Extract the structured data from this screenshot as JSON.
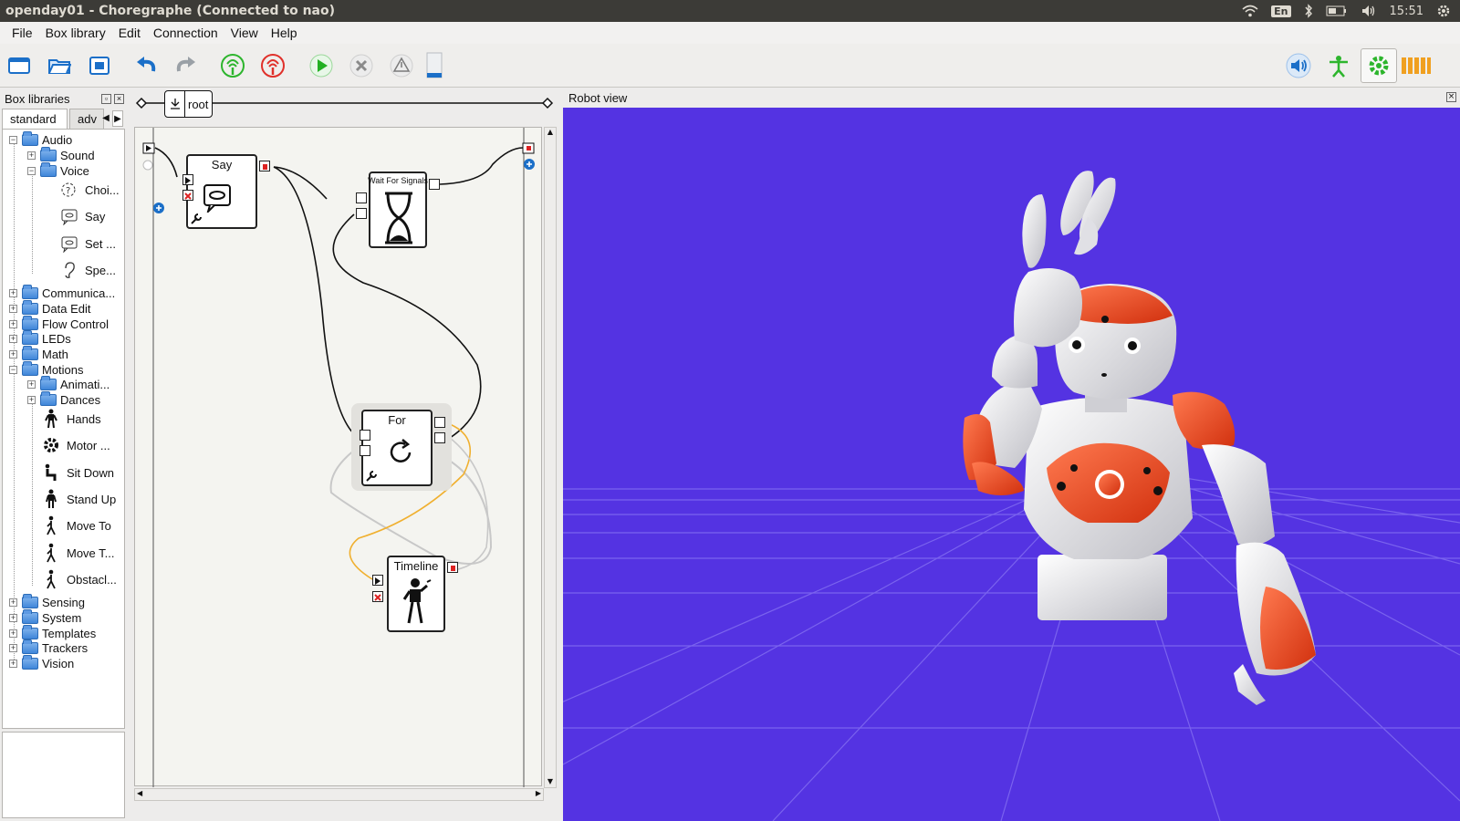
{
  "window": {
    "title": "openday01 - Choregraphe (Connected to nao)",
    "keyboard_layout": "En",
    "clock": "15:51"
  },
  "menu": [
    "File",
    "Box library",
    "Edit",
    "Connection",
    "View",
    "Help"
  ],
  "toolbar": {
    "left_icons": [
      "new-project-icon",
      "open-project-icon",
      "save-project-icon",
      "undo-icon",
      "redo-icon",
      "connect-icon",
      "disconnect-icon",
      "play-icon",
      "stop-icon",
      "warning-icon",
      "battery-icon"
    ],
    "right_icons": [
      "volume-icon",
      "robot-stiffness-icon",
      "autonomous-life-icon",
      "battery-level-icon"
    ]
  },
  "box_libraries": {
    "title": "Box libraries",
    "tabs": [
      "standard",
      "adv"
    ],
    "tree": {
      "audio": "Audio",
      "sound": "Sound",
      "voice": "Voice",
      "voice_items": [
        "Choi...",
        "Say",
        "Set ...",
        "Spe..."
      ],
      "communication": "Communica...",
      "data_edit": "Data Edit",
      "flow_control": "Flow Control",
      "leds": "LEDs",
      "math": "Math",
      "motions": "Motions",
      "animations": "Animati...",
      "dances": "Dances",
      "motion_items": [
        "Hands",
        "Motor ...",
        "Sit Down",
        "Stand Up",
        "Move To",
        "Move T...",
        "Obstacl..."
      ],
      "sensing": "Sensing",
      "system": "System",
      "templates": "Templates",
      "trackers": "Trackers",
      "vision": "Vision"
    }
  },
  "flow": {
    "breadcrumb": "root",
    "boxes": {
      "say": "Say",
      "wait": "Wait For Signals",
      "for": "For",
      "timeline": "Timeline"
    }
  },
  "robot_view": {
    "title": "Robot view",
    "colors": {
      "background": "#5433e2",
      "grid": "#8f7cf0",
      "robot_shell": "#f0f0f0",
      "robot_accent": "#e8401c"
    }
  }
}
